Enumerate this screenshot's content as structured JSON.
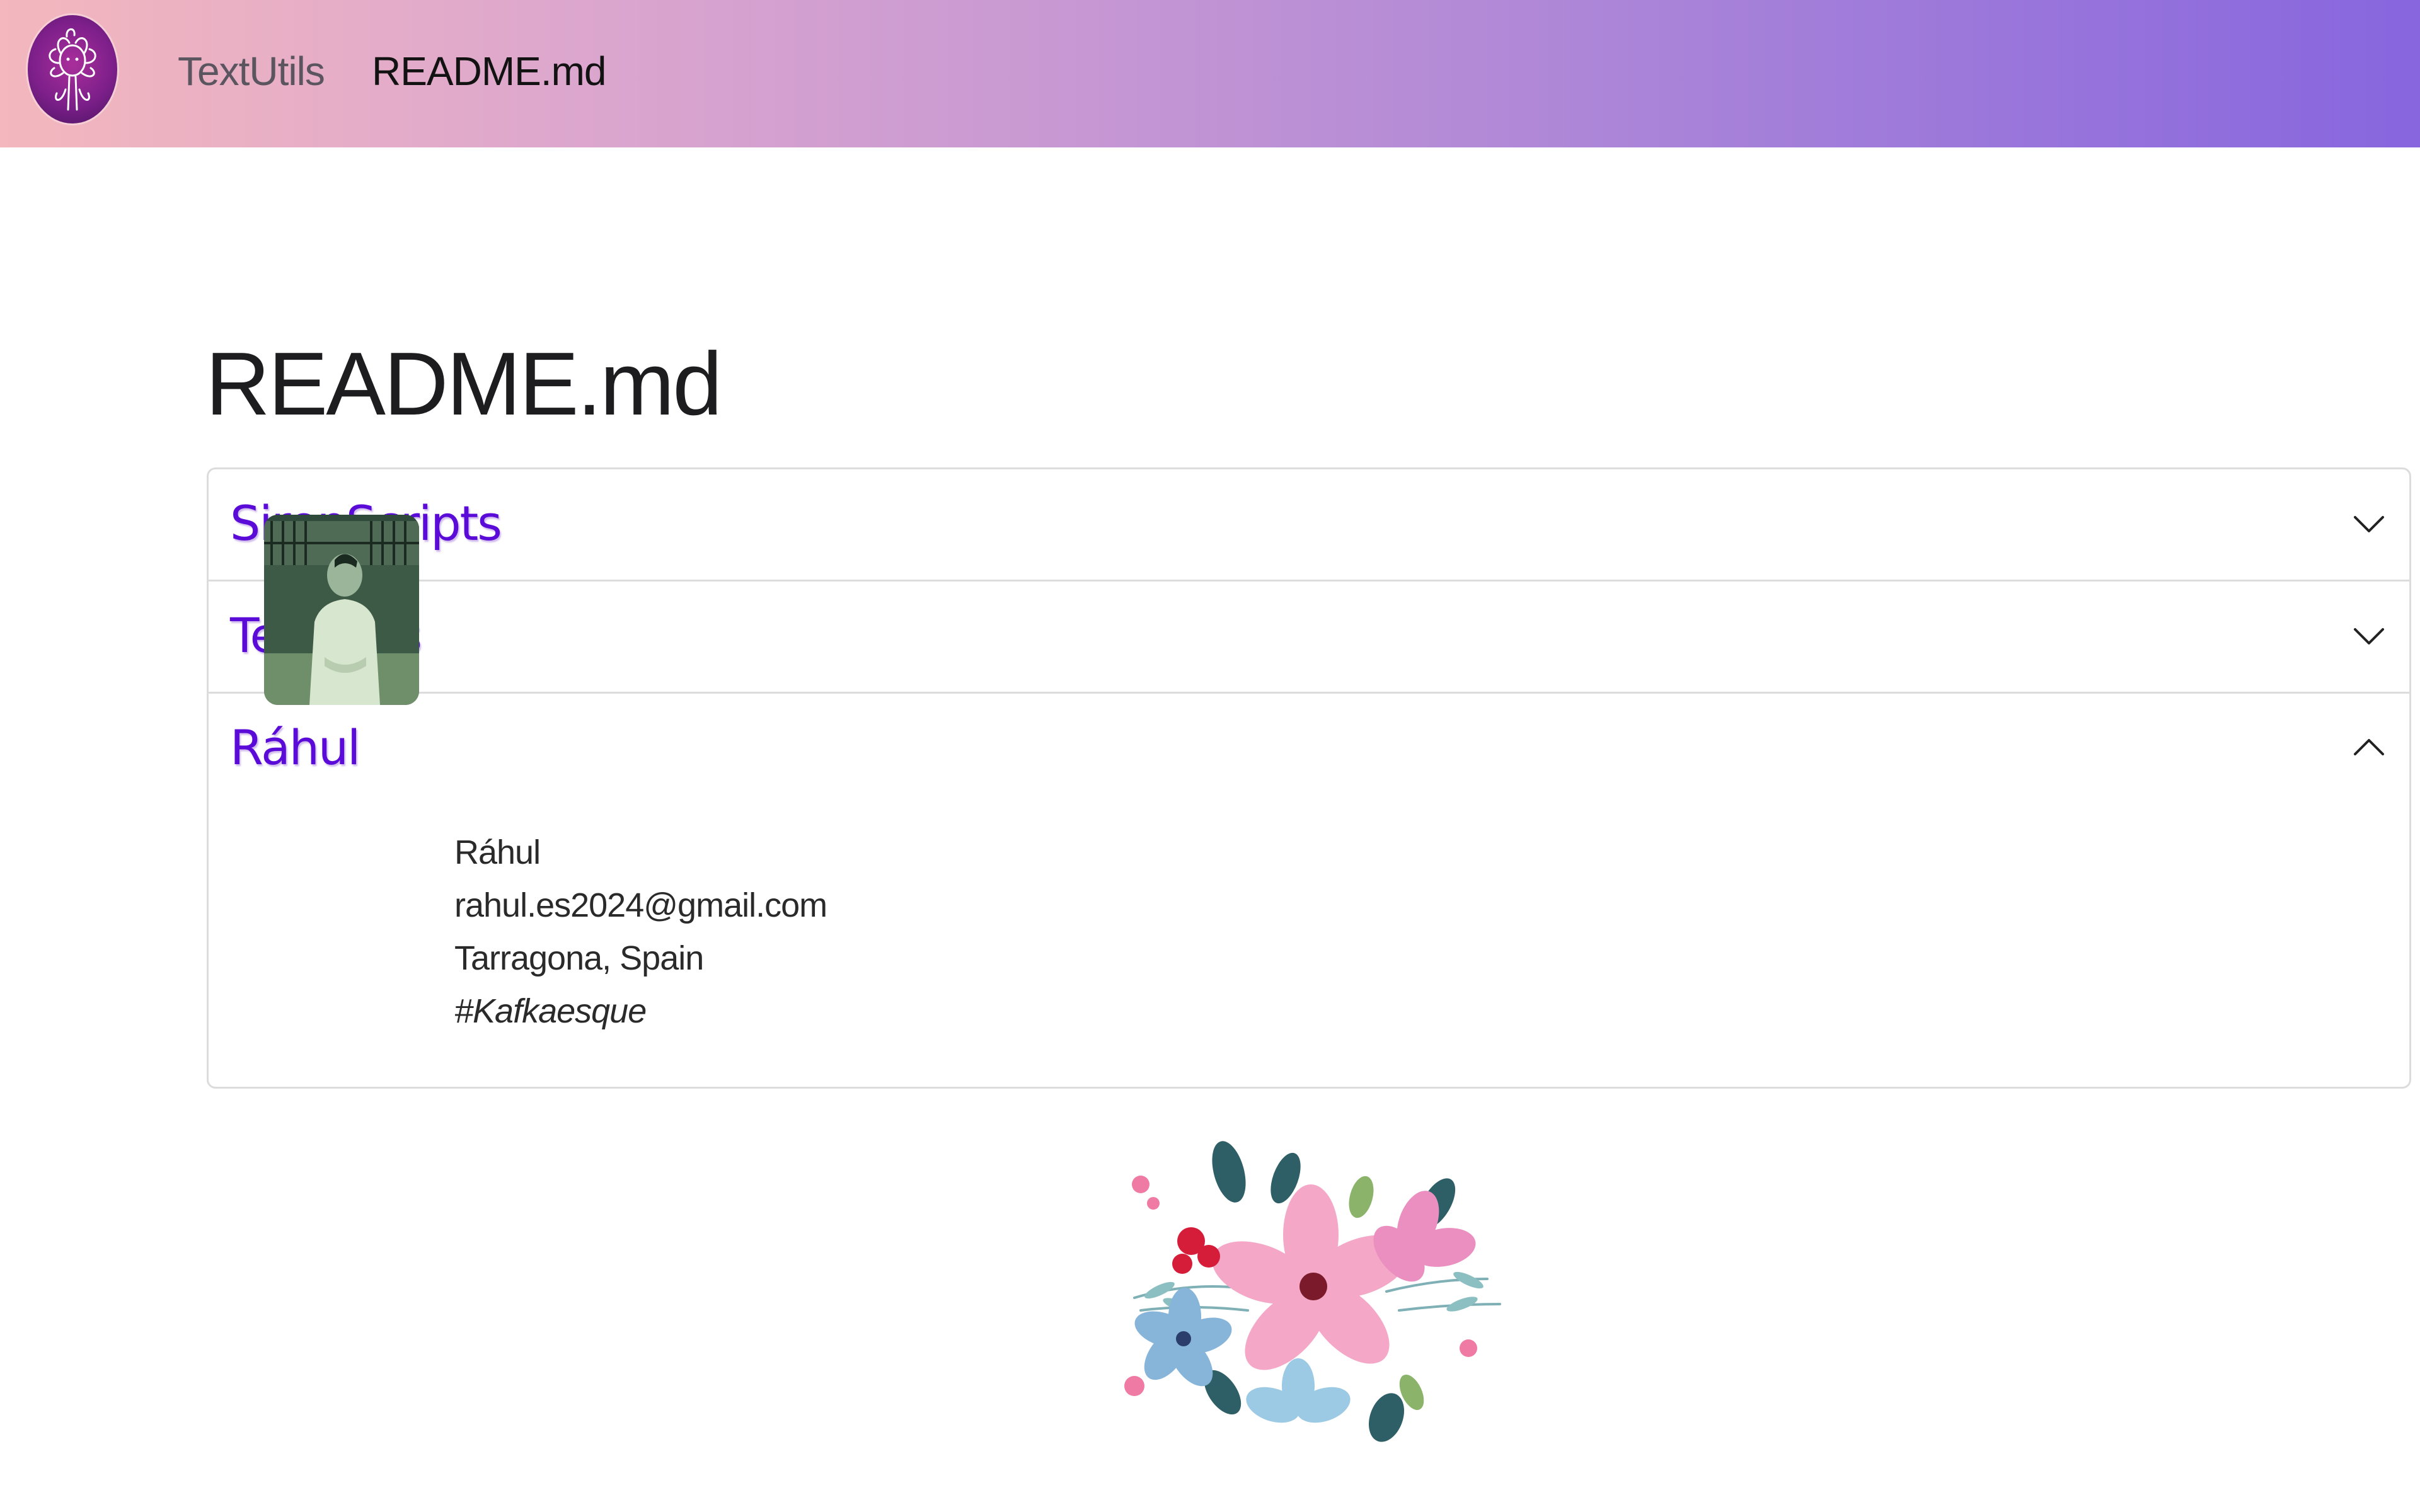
{
  "navbar": {
    "logo_icon": "medusa-logo-icon",
    "brand_label": "TextUtils",
    "links": [
      {
        "label": "README.md"
      }
    ],
    "gradient_colors": [
      "#f3b7bd",
      "#c697d3",
      "#8766de"
    ]
  },
  "page": {
    "title": "README.md"
  },
  "accordion": {
    "accent_color": "#5b0bd8",
    "items": [
      {
        "title": "SirenScripts",
        "expanded": false,
        "icon": "chevron-down-icon"
      },
      {
        "title": "TextUtils",
        "expanded": false,
        "icon": "chevron-down-icon"
      },
      {
        "title": "Ráhul",
        "expanded": true,
        "icon": "chevron-up-icon"
      }
    ],
    "profile": {
      "name": "Ráhul",
      "email": "rahul.es2024@gmail.com",
      "location": "Tarragona, Spain",
      "tagline": "#Kafkaesque"
    }
  },
  "decoration": {
    "image": "watercolor-floral-bouquet"
  }
}
